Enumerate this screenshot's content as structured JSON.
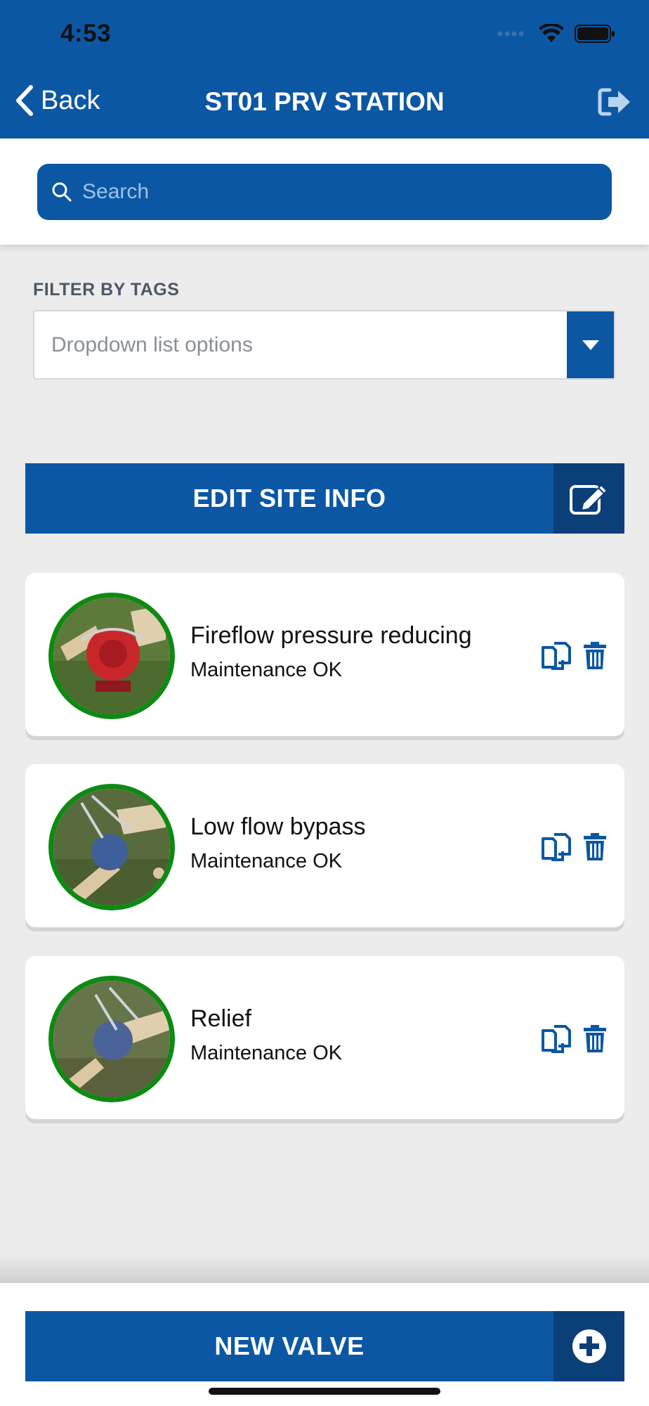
{
  "status_bar": {
    "time": "4:53"
  },
  "nav": {
    "back_label": "Back",
    "title": "ST01 PRV STATION"
  },
  "search": {
    "placeholder": "Search"
  },
  "filter": {
    "label": "FILTER BY TAGS",
    "dropdown_placeholder": "Dropdown list options"
  },
  "edit_site_button": {
    "label": "EDIT SITE INFO"
  },
  "valves": [
    {
      "name": "Fireflow pressure reducing",
      "status": "Maintenance OK",
      "valve_color": "#c9262b"
    },
    {
      "name": "Low flow bypass",
      "status": "Maintenance OK",
      "valve_color": "#3f5f9a"
    },
    {
      "name": "Relief",
      "status": "Maintenance OK",
      "valve_color": "#4a6398"
    }
  ],
  "new_valve_button": {
    "label": "NEW VALVE"
  },
  "colors": {
    "primary": "#0b57a4",
    "primary_dark": "#0a3f78",
    "status_ring": "#0e8a13",
    "background": "#ececec"
  }
}
